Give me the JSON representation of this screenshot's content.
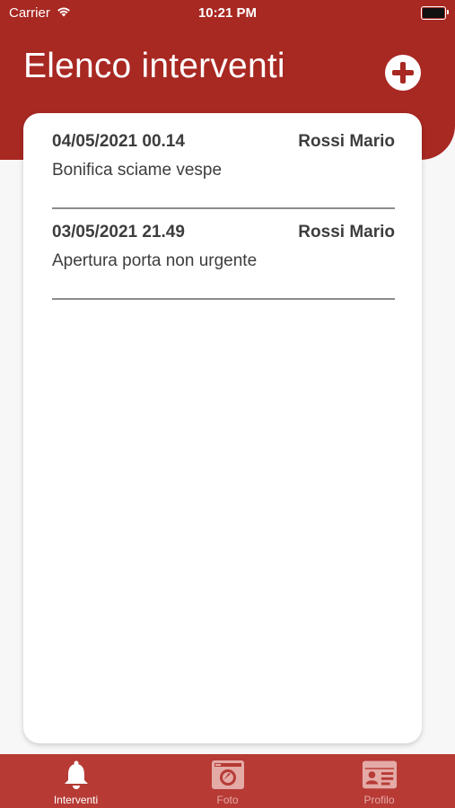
{
  "status_bar": {
    "carrier": "Carrier",
    "time": "10:21 PM"
  },
  "header": {
    "title": "Elenco interventi",
    "add_icon": "plus-circle-icon"
  },
  "interventions": [
    {
      "date": "04/05/2021 00.14",
      "person": "Rossi Mario",
      "description": "Bonifica sciame vespe"
    },
    {
      "date": "03/05/2021 21.49",
      "person": "Rossi Mario",
      "description": "Apertura porta non urgente"
    }
  ],
  "tabs": [
    {
      "label": "Interventi",
      "icon": "bell-icon",
      "active": true
    },
    {
      "label": "Foto",
      "icon": "camera-icon",
      "active": false
    },
    {
      "label": "Profilo",
      "icon": "id-card-icon",
      "active": false
    }
  ],
  "colors": {
    "brand_red": "#a82822",
    "tab_bar": "#b73a35",
    "tab_inactive": "#e4aaa6"
  }
}
